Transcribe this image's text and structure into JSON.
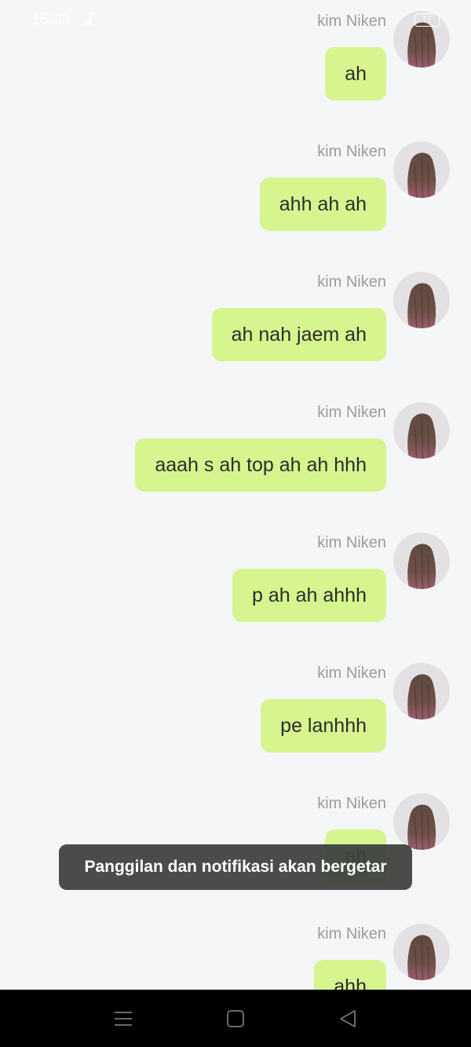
{
  "status_bar": {
    "time": "15.33",
    "battery": "77"
  },
  "chat": {
    "messages": [
      {
        "sender": "kim Niken",
        "text": "ah"
      },
      {
        "sender": "kim Niken",
        "text": "ahh ah ah"
      },
      {
        "sender": "kim Niken",
        "text": "ah nah jaem ah"
      },
      {
        "sender": "kim Niken",
        "text": "aaah s ah top ah ah hhh"
      },
      {
        "sender": "kim Niken",
        "text": "p ah ah ahhh"
      },
      {
        "sender": "kim Niken",
        "text": "pe lanhhh"
      },
      {
        "sender": "kim Niken",
        "text": "ah"
      },
      {
        "sender": "kim Niken",
        "text": "ahh"
      }
    ]
  },
  "toast": {
    "text": "Panggilan dan notifikasi akan bergetar"
  },
  "nav_bar": {
    "menu_icon": "menu-icon",
    "home_icon": "home-icon",
    "back_icon": "back-icon"
  },
  "colors": {
    "background": "#f5f6f8",
    "bubble": "#d6f58f",
    "sender_name": "#9c9c9c",
    "toast_bg": "#3c3e3c",
    "nav_bg": "#000000"
  }
}
